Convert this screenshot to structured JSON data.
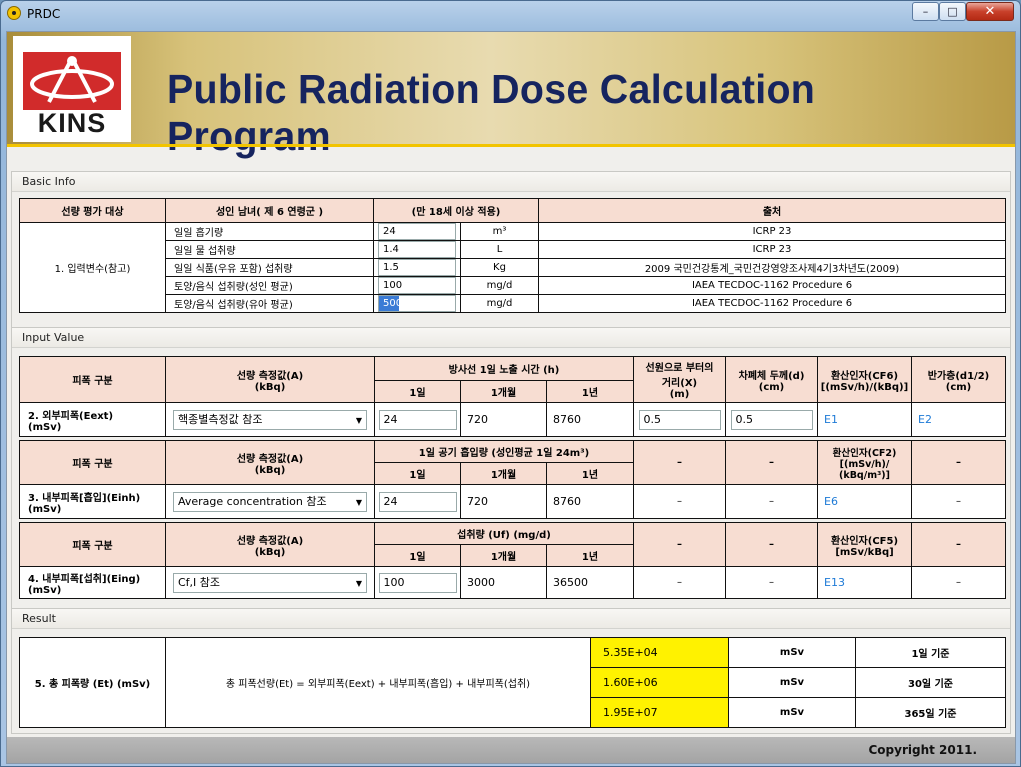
{
  "window": {
    "title": "PRDC",
    "minimize": "–",
    "maximize": "□",
    "close": "✕",
    "icon": "radiation-icon"
  },
  "banner": {
    "logo_text": "KINS",
    "title": "Public Radiation Dose Calculation Program"
  },
  "basic_info": {
    "group_title": "Basic Info",
    "headers": [
      "선량 평가 대상",
      "성인 남녀( 제 6 연령군 )",
      "(만 18세 이상 적용)",
      "출처"
    ],
    "section_label": "1. 입력변수(참고)",
    "rows": [
      {
        "label": "일일 흡기량",
        "value": "24",
        "unit": "m³",
        "source": "ICRP 23"
      },
      {
        "label": "일일 물 섭취량",
        "value": "1.4",
        "unit": "L",
        "source": "ICRP 23"
      },
      {
        "label": "일일 식품(우유 포함) 섭취량",
        "value": "1.5",
        "unit": "Kg",
        "source": "2009 국민건강통계_국민건강영양조사제4기3차년도(2009)"
      },
      {
        "label": "토양/음식 섭취량(성인 평균)",
        "value": "100",
        "unit": "mg/d",
        "source": "IAEA TECDOC-1162 Procedure 6"
      },
      {
        "label": "토양/음식 섭취량(유아 평균)",
        "value": "500",
        "unit": "mg/d",
        "source": "IAEA TECDOC-1162 Procedure 6"
      }
    ]
  },
  "input_value": {
    "group_title": "Input Value",
    "ext": {
      "h_category": "피폭 구분",
      "h_measure": "선량 측정값(A)\n(kBq)",
      "h_time": "방사선 1일 노출 시간 (h)",
      "h_cols": [
        "1일",
        "1개월",
        "1년"
      ],
      "h_distance": "선원으로 부터의\n거리(X)\n(m)",
      "h_shield": "차폐체 두께(d)\n(cm)",
      "h_cf": "환산인자(CF6)\n[(mSv/h)/(kBq)]",
      "h_half": "반가층(d1/2)\n(cm)",
      "label": "2. 외부피폭(Eext)\n(mSv)",
      "select": "핵종별측정값 참조",
      "day": "24",
      "month": "720",
      "year": "8760",
      "distance": "0.5",
      "shield": "0.5",
      "cf_link": "E1",
      "half_link": "E2"
    },
    "inh": {
      "h_category": "피폭 구분",
      "h_measure": "선량 측정값(A)\n(kBq)",
      "h_time": "1일 공기 흡입량 (성인평균 1일 24m³)",
      "h_cols": [
        "1일",
        "1개월",
        "1년"
      ],
      "h_dash1": "–",
      "h_dash2": "–",
      "h_cf": "환산인자(CF2)\n[(mSv/h)/\n(kBq/m³)]",
      "h_dash3": "–",
      "label": "3. 내부피폭[흡입](Einh)\n(mSv)",
      "select": "Average concentration 참조",
      "day": "24",
      "month": "720",
      "year": "8760",
      "dash1": "–",
      "dash2": "–",
      "cf_link": "E6",
      "dash3": "–"
    },
    "ing": {
      "h_category": "피폭 구분",
      "h_measure": "선량 측정값(A)\n(kBq)",
      "h_time": "섭취량 (Uf) (mg/d)",
      "h_cols": [
        "1일",
        "1개월",
        "1년"
      ],
      "h_dash1": "–",
      "h_dash2": "–",
      "h_cf": "환산인자(CF5)\n[mSv/kBq]",
      "h_dash3": "–",
      "label": "4. 내부피폭[섭취](Eing)\n(mSv)",
      "select": "Cf,I 참조",
      "day": "100",
      "month": "3000",
      "year": "36500",
      "dash1": "–",
      "dash2": "–",
      "cf_link": "E13",
      "dash3": "–"
    }
  },
  "result": {
    "group_title": "Result",
    "label": "5. 총 피폭량 (Et) (mSv)",
    "formula": "총 피폭선량(Et) = 외부피폭(Eext) + 내부피폭(흡입) + 내부피폭(섭취)",
    "rows": [
      {
        "value": "5.35E+04",
        "unit": "mSv",
        "basis": "1일 기준"
      },
      {
        "value": "1.60E+06",
        "unit": "mSv",
        "basis": "30일 기준"
      },
      {
        "value": "1.95E+07",
        "unit": "mSv",
        "basis": "365일 기준"
      }
    ]
  },
  "footer": {
    "copyright": "Copyright 2011."
  },
  "colors": {
    "header_fill": "#f7ddd2",
    "result_fill": "#fff200",
    "link": "#1e7ad6",
    "banner_title": "#16245f"
  }
}
